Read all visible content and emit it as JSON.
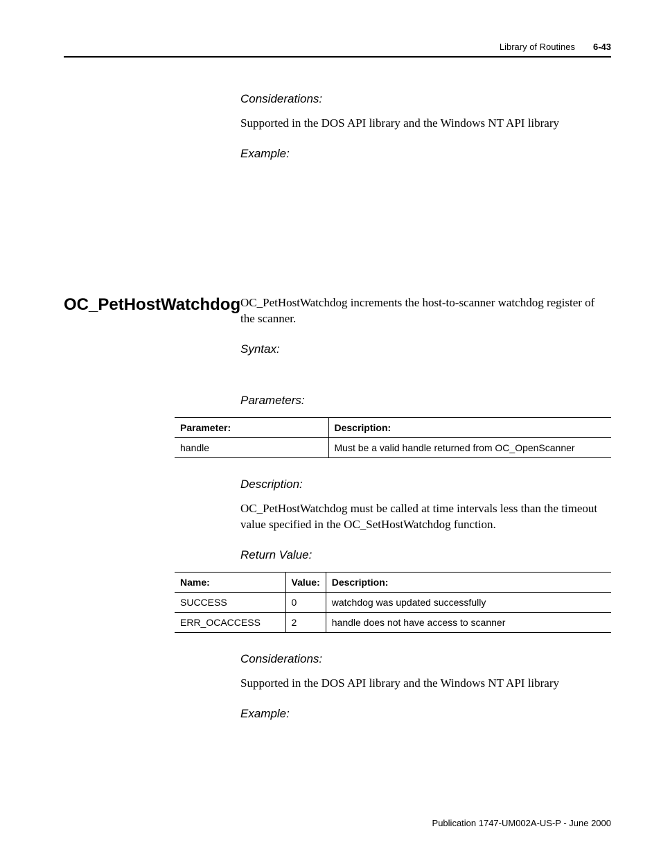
{
  "header": {
    "title": "Library of Routines",
    "pagenum": "6-43"
  },
  "top_section": {
    "considerations_label": "Considerations:",
    "considerations_text": "Supported in the DOS API library and the Windows NT API library",
    "example_label": "Example:"
  },
  "main_section": {
    "heading": "OC_PetHostWatchdog",
    "intro": "OC_PetHostWatchdog increments the host-to-scanner watchdog register of the scanner.",
    "syntax_label": "Syntax:",
    "parameters_label": "Parameters:",
    "param_table": {
      "h1": "Parameter:",
      "h2": "Description:",
      "rows": [
        {
          "p": "handle",
          "d": "Must be a valid handle returned from OC_OpenScanner"
        }
      ]
    },
    "description_label": "Description:",
    "description_text": "OC_PetHostWatchdog must be called at time intervals less than the timeout value specified in the OC_SetHostWatchdog function.",
    "return_label": "Return Value:",
    "ret_table": {
      "h1": "Name:",
      "h2": "Value:",
      "h3": "Description:",
      "rows": [
        {
          "n": "SUCCESS",
          "v": "0",
          "d": "watchdog was updated successfully"
        },
        {
          "n": "ERR_OCACCESS",
          "v": "2",
          "d": "handle does not have access to scanner"
        }
      ]
    },
    "considerations_label": "Considerations:",
    "considerations_text": "Supported in the DOS API library and the Windows NT API library",
    "example_label": "Example:"
  },
  "footer": {
    "text": "Publication 1747-UM002A-US-P - June 2000"
  }
}
